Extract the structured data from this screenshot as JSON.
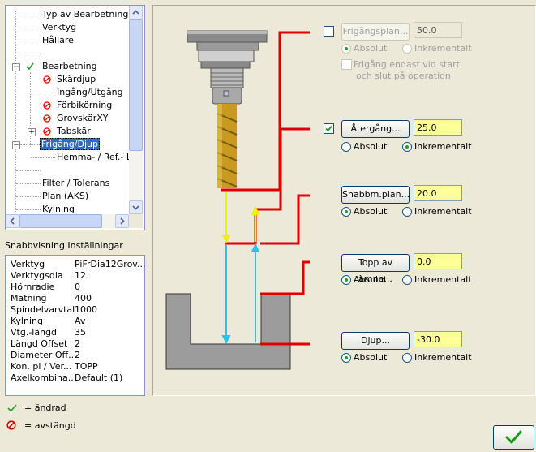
{
  "tree": {
    "items": [
      {
        "label": "Typ av Bearbetning"
      },
      {
        "label": "Verktyg"
      },
      {
        "label": "Hållare"
      },
      {
        "label": ""
      },
      {
        "label": "Bearbetning"
      },
      {
        "label": "Skärdjup"
      },
      {
        "label": "Ingång/Utgång"
      },
      {
        "label": "Förbikörning"
      },
      {
        "label": "GrovskärXY"
      },
      {
        "label": "Tabskär"
      },
      {
        "label": "Frigång/Djup"
      },
      {
        "label": "Hemma- / Ref.- Lä"
      },
      {
        "label": ""
      },
      {
        "label": "Filter / Tolerans"
      },
      {
        "label": "Plan (AKS)"
      },
      {
        "label": "Kylning"
      }
    ]
  },
  "quickview": {
    "title": "Snabbvisning Inställningar",
    "rows": [
      {
        "k": "Verktyg",
        "v": "PiFrDia12Grov..."
      },
      {
        "k": "Verktygsdia",
        "v": "12"
      },
      {
        "k": "Hörnradie",
        "v": "0"
      },
      {
        "k": "Matning",
        "v": "400"
      },
      {
        "k": "Spindelvarvtal",
        "v": "1000"
      },
      {
        "k": "Kylning",
        "v": "Av"
      },
      {
        "k": "Vtg.-längd",
        "v": "35"
      },
      {
        "k": "Längd Offset",
        "v": "2"
      },
      {
        "k": "Diameter Off...",
        "v": "2"
      },
      {
        "k": "Kon. pl / Ver...",
        "v": "TOPP"
      },
      {
        "k": "Axelkombina...",
        "v": "Default (1)"
      }
    ]
  },
  "legend": {
    "changed": "= ändrad",
    "disabled": "= avstängd"
  },
  "params": {
    "clearance": {
      "label": "Frigångsplan...",
      "value": "50.0",
      "absolute": "Absolut",
      "incremental": "Inkrementalt",
      "only_start_end": "Frigång endast vid start",
      "only_start_end_2": "och slut på operation"
    },
    "retract": {
      "label": "Återgång...",
      "value": "25.0",
      "absolute": "Absolut",
      "incremental": "Inkrementalt"
    },
    "feedplane": {
      "label": "Snabbm.plan...",
      "value": "20.0",
      "absolute": "Absolut",
      "incremental": "Inkrementalt"
    },
    "topstock": {
      "label": "Topp av ämne...",
      "value": "0.0",
      "absolute": "Absolut",
      "incremental": "Inkrementalt"
    },
    "depth": {
      "label": "Djup...",
      "value": "-30.0",
      "absolute": "Absolut",
      "incremental": "Inkrementalt"
    }
  },
  "colors": {
    "accent_red": "#e00000",
    "yellow": "#ffff99",
    "cyan": "#27c4e8",
    "selection": "#316ac5"
  },
  "icons": {
    "changed": "check-icon",
    "disabled": "disabled-icon",
    "ok": "check-icon"
  }
}
